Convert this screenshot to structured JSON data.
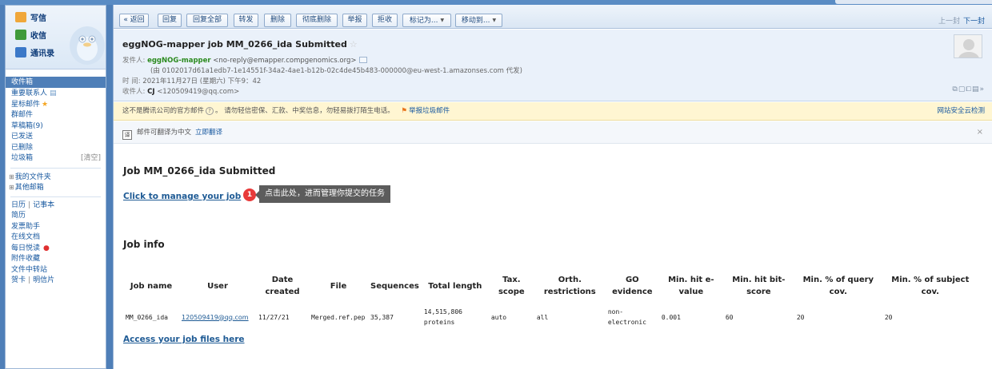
{
  "sidebar": {
    "actions": {
      "write": "写信",
      "receive": "收信",
      "contacts": "通讯录"
    },
    "folders": {
      "inbox": "收件箱",
      "important": "重要联系人",
      "starred": "星标邮件",
      "group": "群邮件",
      "drafts": "草稿箱(9)",
      "sent": "已发送",
      "deleted": "已删除",
      "spam": "垃圾箱",
      "spam_clear": "[清空]"
    },
    "groups": {
      "my_folders": "我的文件夹",
      "other_mail": "其他邮箱"
    },
    "tools": {
      "calendar": "日历",
      "notes": "记事本",
      "resume": "简历",
      "invoice": "发票助手",
      "docs": "在线文档",
      "reading": "每日悦读",
      "attachments": "附件收藏",
      "transfer": "文件中转站",
      "cards": "贺卡",
      "postcards": "明信片"
    }
  },
  "toolbar": {
    "back": "« 返回",
    "reply": "回复",
    "reply_all": "回复全部",
    "forward": "转发",
    "delete": "删除",
    "perm_delete": "彻底删除",
    "report": "举报",
    "reject": "拒收",
    "mark_as": "标记为...",
    "move_to": "移动到...",
    "prev": "上一封",
    "next": "下一封"
  },
  "header": {
    "subject": "eggNOG-mapper job MM_0266_ida Submitted",
    "from_label": "发件人:",
    "sender_name": "eggNOG-mapper",
    "sender_addr": "<no-reply@emapper.compgenomics.org>",
    "via": "(由 0102017d61a1edb7-1e14551f-34a2-4ae1-b12b-02c4de45b483-000000@eu-west-1.amazonses.com 代发)",
    "time_label": "时  间:",
    "time_value": "2021年11月27日 (星期六) 下午9：42",
    "to_label": "收件人:",
    "to_name": "CJ",
    "to_addr": "<120509419@qq.com>"
  },
  "warning": {
    "text_a": "这不是腾讯公司的官方邮件",
    "text_b": "。 请勿轻信密保、汇款、中奖信息，勿轻易拨打陌生电话。",
    "report": "举报垃圾邮件",
    "safety": "网站安全云检测"
  },
  "translate": {
    "icon": "译",
    "text": "邮件可翻译为中文",
    "link": "立即翻译",
    "close": "×"
  },
  "body": {
    "job_title": "Job MM_0266_ida Submitted",
    "manage_link": "Click to manage your job",
    "badge": "1",
    "tooltip": "点击此处，进而管理你提交的任务",
    "info_title": "Job info",
    "files_link": "Access your job files here"
  },
  "job_table": {
    "headers": [
      "Job name",
      "User",
      "Date created",
      "File",
      "Sequences",
      "Total length",
      "Tax. scope",
      "Orth. restrictions",
      "GO evidence",
      "Min. hit e-value",
      "Min. hit bit-score",
      "Min. % of query cov.",
      "Min. % of subject cov."
    ],
    "row": [
      "MM_0266_ida",
      "120509419@qq.com",
      "11/27/21",
      "Merged.ref.pep",
      "35,387",
      "14,515,806 proteins",
      "auto",
      "all",
      "non-electronic",
      "0.001",
      "60",
      "20",
      "20"
    ]
  }
}
